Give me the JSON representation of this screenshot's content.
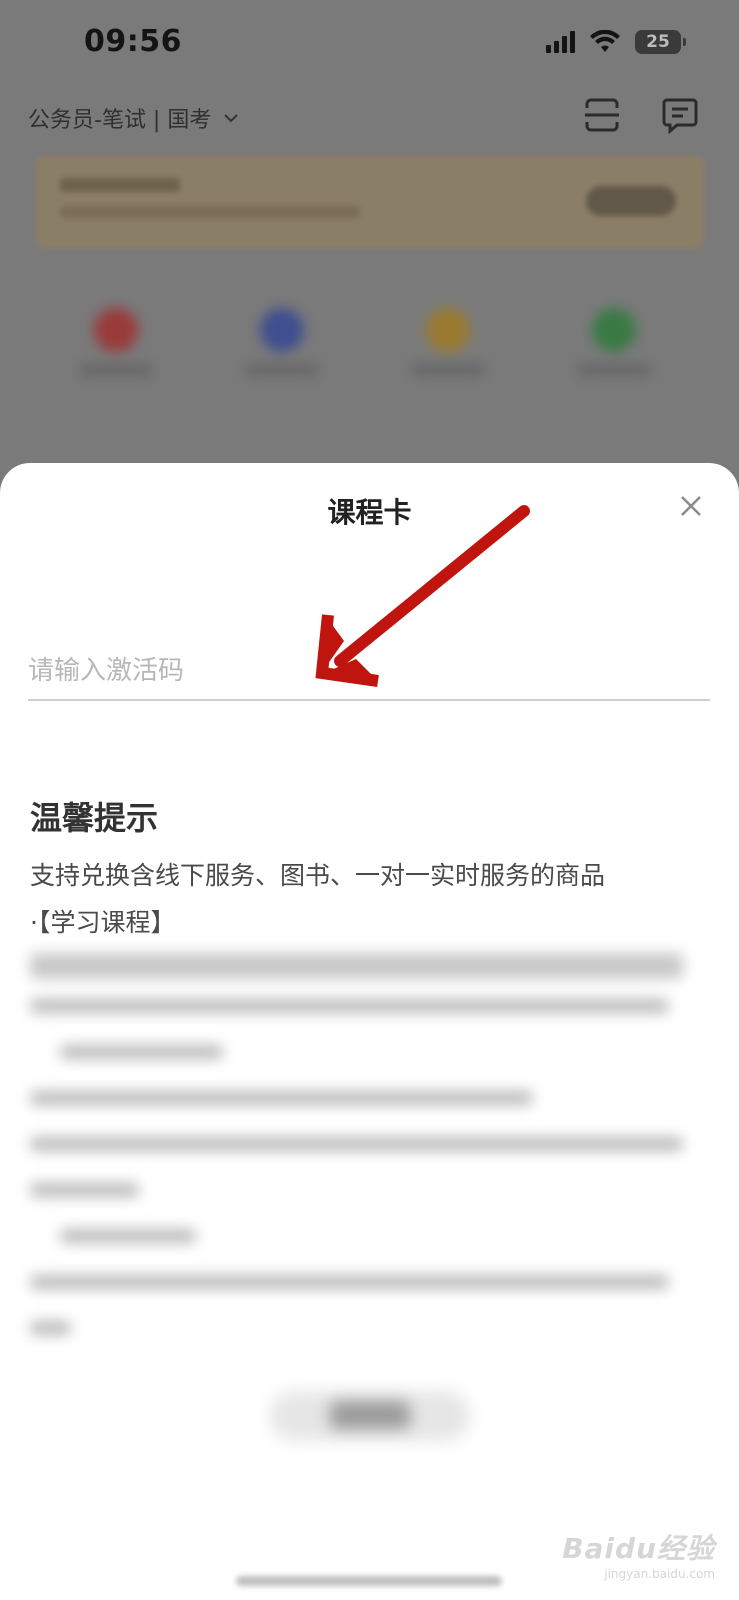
{
  "status_bar": {
    "time": "09:56",
    "battery": "25"
  },
  "topbar": {
    "exam_selector": "公务员-笔试 | 国考"
  },
  "icons": {
    "scan": "scan-icon",
    "message": "message-icon",
    "close": "close-icon",
    "chevron": "chevron-down-icon"
  },
  "sheet": {
    "title": "课程卡",
    "input_placeholder": "请输入激活码",
    "tips_title": "温馨提示",
    "tips_line1": "支持兑换含线下服务、图书、一对一实时服务的商品",
    "tips_line2": "·【学习课程】"
  },
  "watermark": {
    "brand": "Baidu经验",
    "url": "jingyan.baidu.com"
  },
  "colors": {
    "arrow": "#c0140f",
    "overlay": "#7a7a7a",
    "sheet": "#ffffff"
  }
}
